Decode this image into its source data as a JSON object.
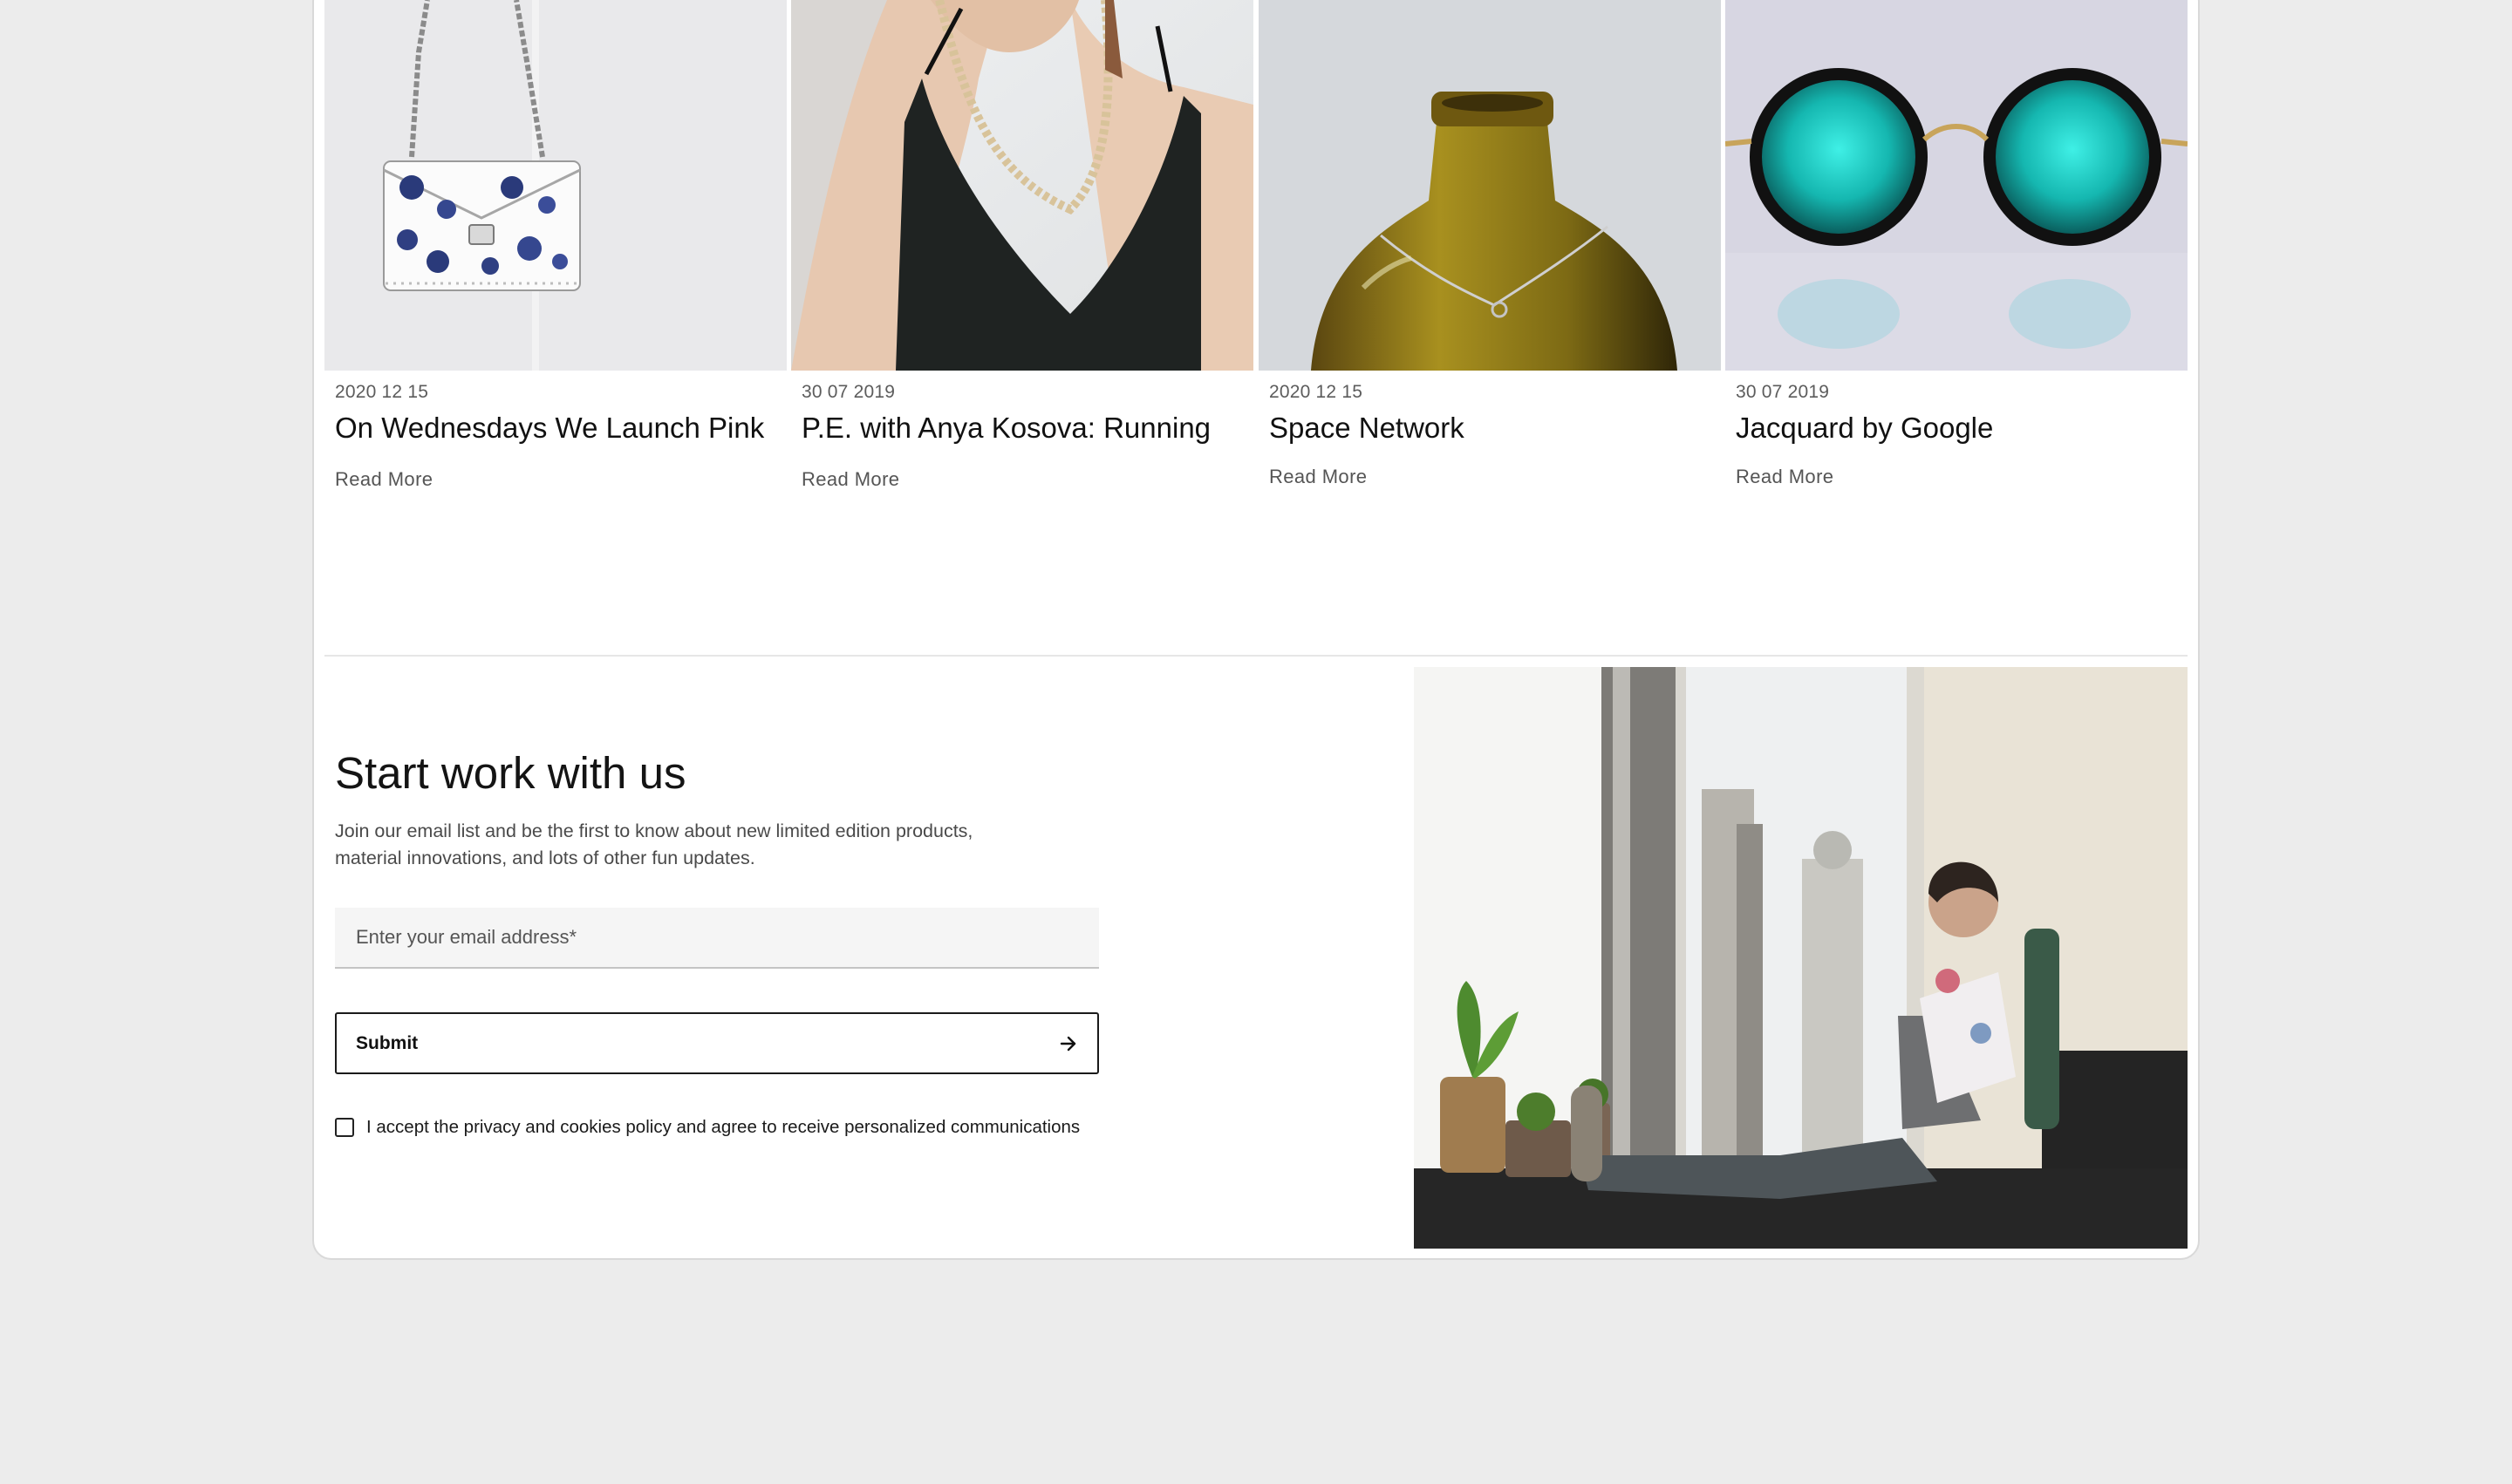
{
  "posts": [
    {
      "date": "2020 12 15",
      "title": "On Wednesdays We Launch Pink",
      "link_label": "Read More",
      "image_name": "floral-chain-handbag-photo"
    },
    {
      "date": "30 07 2019",
      "title": "P.E. with Anya Kosova: Running",
      "link_label": "Read More",
      "image_name": "woman-necklace-black-top-photo"
    },
    {
      "date": "2020 12 15",
      "title": "Space Network",
      "link_label": "Read More",
      "image_name": "amber-glass-bottle-photo"
    },
    {
      "date": "30 07 2019",
      "title": "Jacquard by Google",
      "link_label": "Read More",
      "image_name": "round-teal-sunglasses-photo"
    }
  ],
  "newsletter": {
    "title": "Start work with us",
    "description_line_1": "Join our email list and be the first to know about new limited edition products,",
    "description_line_2": "material innovations, and lots of other fun updates.",
    "email_placeholder": "Enter your email address*",
    "email_value": "",
    "submit_label": "Submit",
    "submit_icon": "arrow-right-icon",
    "consent_label": "I accept the privacy and cookies policy and agree to receive personalized communications",
    "consent_checked": false,
    "image_name": "woman-laptop-window-photo"
  }
}
